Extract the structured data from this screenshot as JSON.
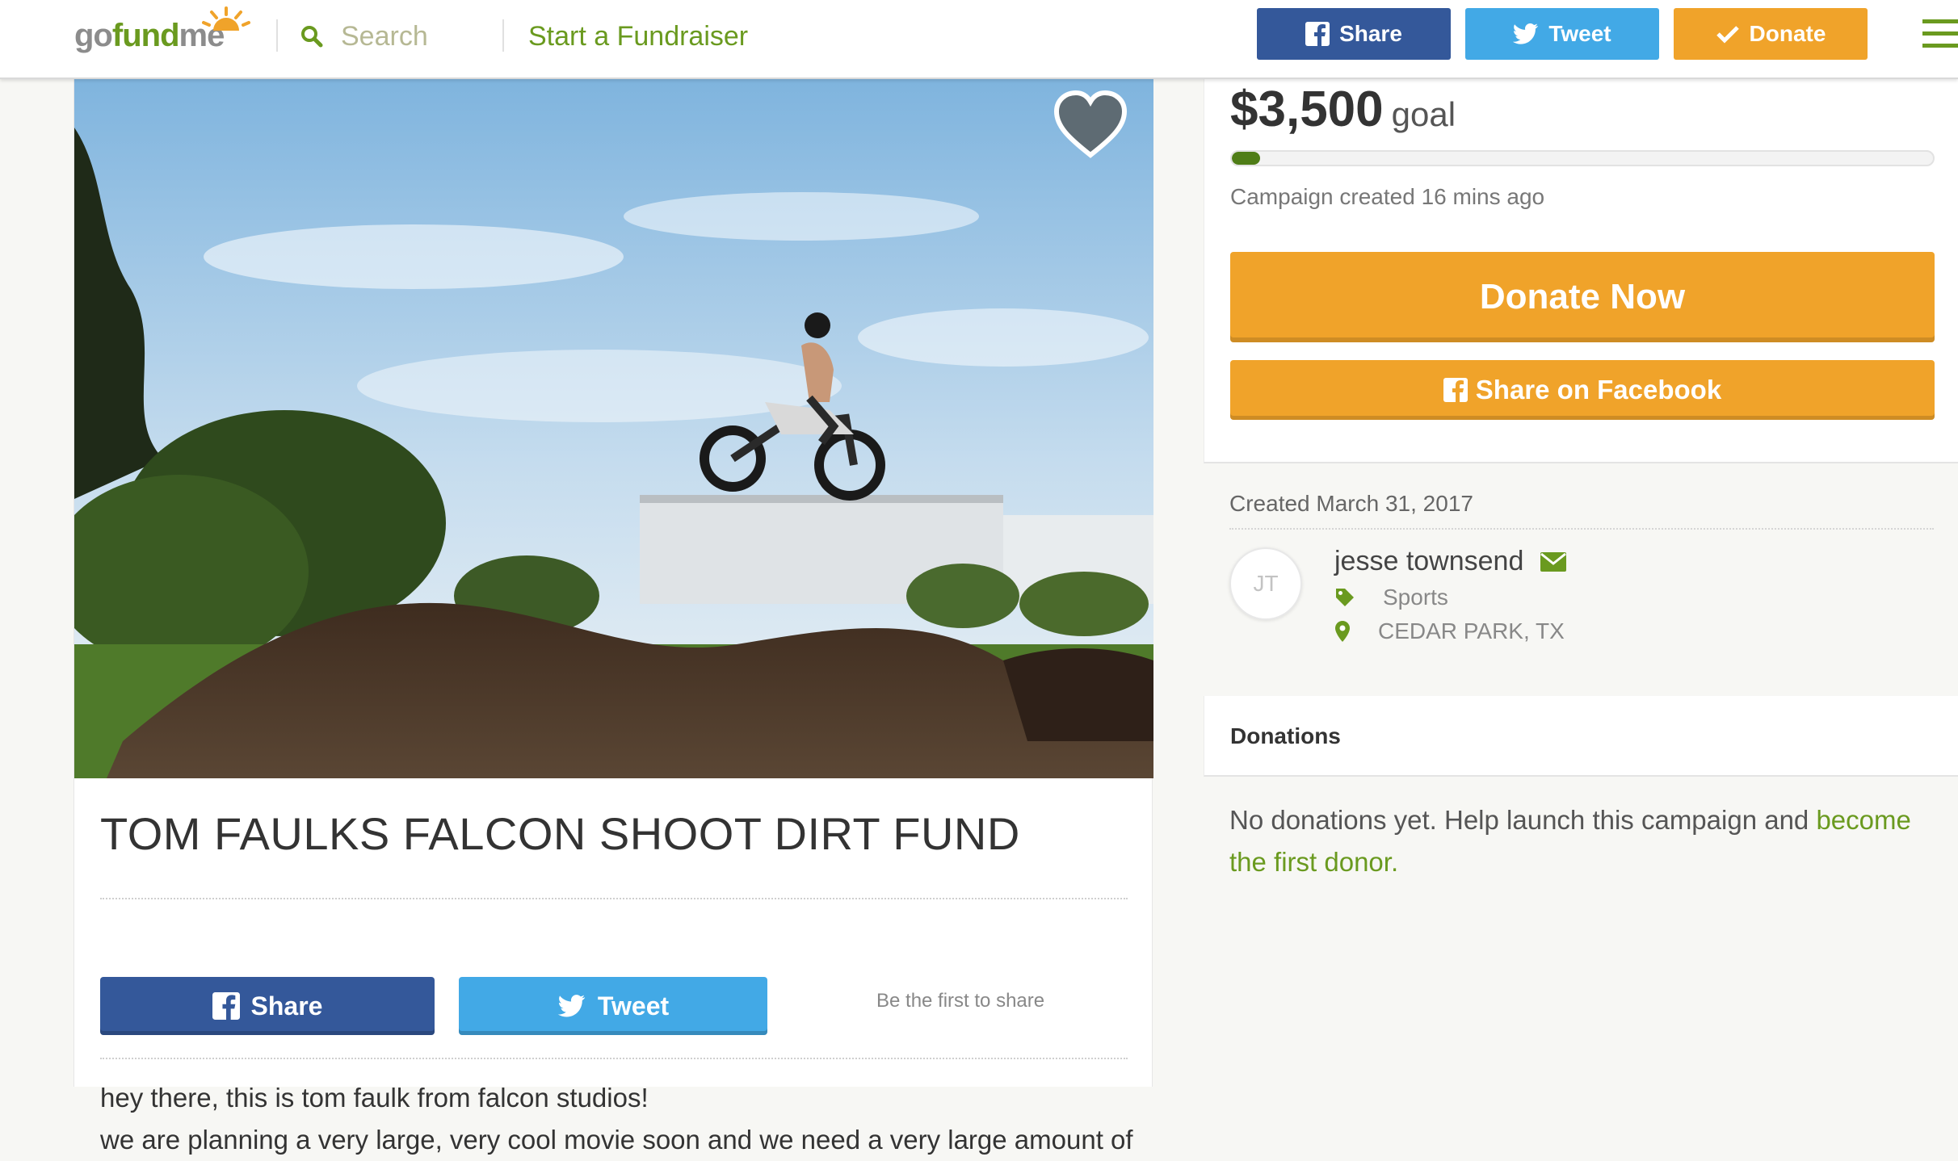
{
  "header": {
    "logo_text_go": "go",
    "logo_text_fund": "fund",
    "logo_text_me": "me",
    "search_placeholder": "Search",
    "start_fundraiser": "Start a Fundraiser",
    "share_label": "Share",
    "tweet_label": "Tweet",
    "donate_label": "Donate"
  },
  "campaign": {
    "title": "TOM FAULKS FALCON SHOOT DIRT FUND",
    "share_label": "Share",
    "tweet_label": "Tweet",
    "first_share_text": "Be the first to share",
    "story_line1": "hey there, this is tom faulk from falcon studios!",
    "story_line2": "we are planning a very large, very cool movie soon and  we need a very large amount of"
  },
  "sidebar": {
    "goal_amount": "$3,500",
    "goal_word": "goal",
    "progress_fraction": 0.04,
    "created_ago": "Campaign created 16 mins ago",
    "donate_now": "Donate Now",
    "share_on_facebook": "Share on Facebook",
    "created_date": "Created March 31, 2017",
    "organizer_initials": "JT",
    "organizer_name": "jesse townsend",
    "category": "Sports",
    "location": "CEDAR PARK, TX",
    "donations_heading": "Donations",
    "no_donations_text": "No donations yet. Help launch this campaign and ",
    "no_donations_link": "become the first donor."
  },
  "colors": {
    "brand_green": "#6a9a1f",
    "facebook_blue": "#34589a",
    "twitter_blue": "#42a9e6",
    "donate_orange": "#f0a32a"
  },
  "icons": [
    "search-icon",
    "facebook-icon",
    "twitter-icon",
    "check-icon",
    "menu-icon",
    "heart-icon",
    "envelope-icon",
    "tag-icon",
    "map-pin-icon"
  ]
}
